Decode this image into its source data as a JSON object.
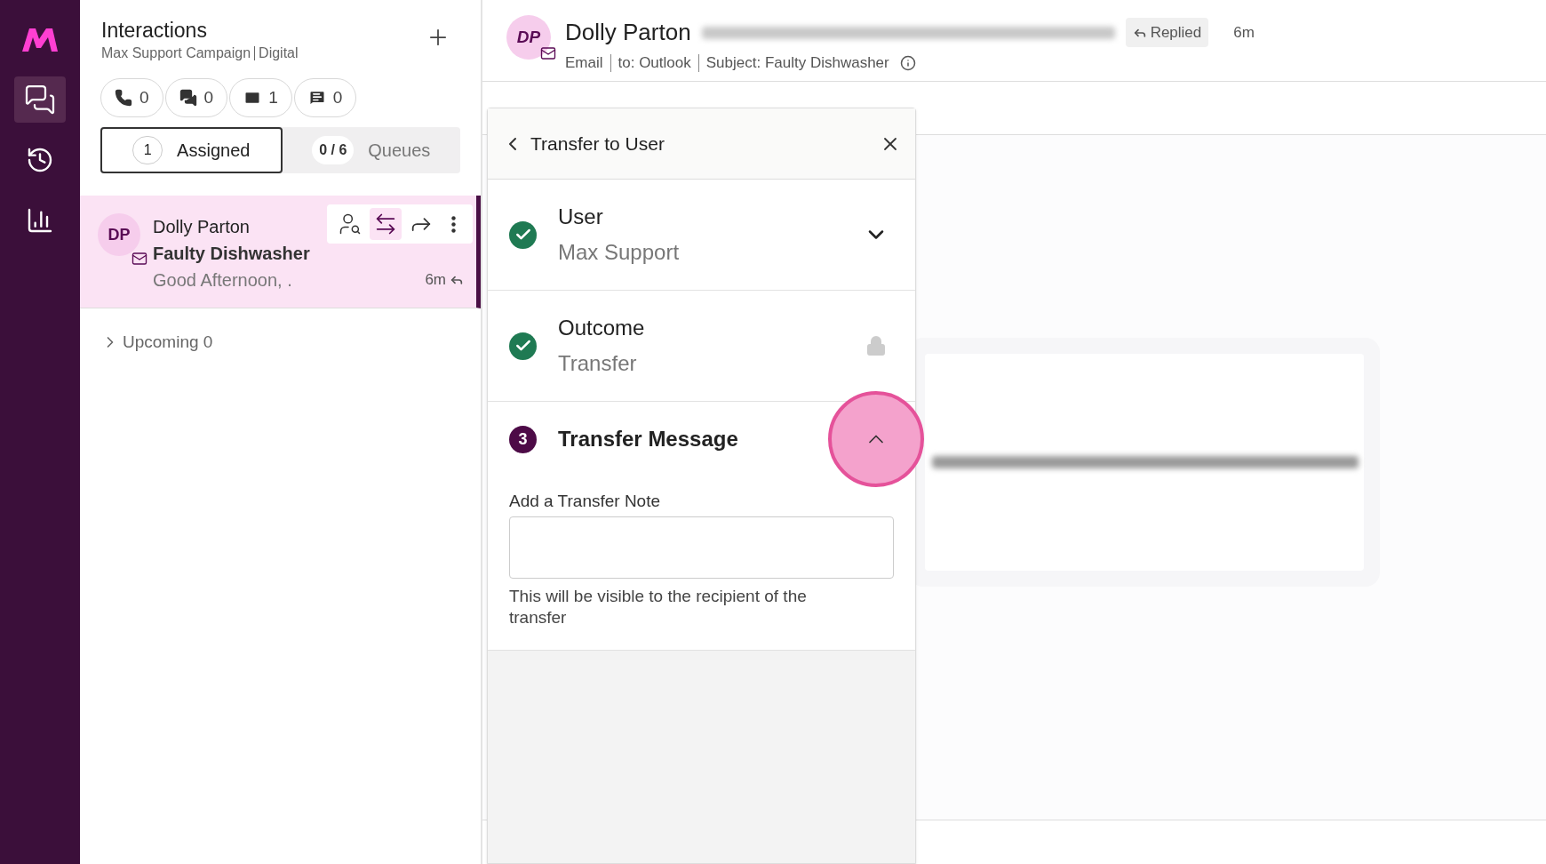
{
  "nav": {
    "items": [
      {
        "kind": "interactions",
        "selected": true
      },
      {
        "kind": "history",
        "selected": false
      },
      {
        "kind": "reports",
        "selected": false
      }
    ]
  },
  "interactions": {
    "title": "Interactions",
    "campaign": "Max Support Campaign",
    "channel": "Digital",
    "counters": [
      {
        "kind": "phone",
        "count": "0"
      },
      {
        "kind": "chat",
        "count": "0"
      },
      {
        "kind": "email",
        "count": "1"
      },
      {
        "kind": "sms",
        "count": "0"
      }
    ],
    "tabs": [
      {
        "label": "Assigned",
        "count": "1",
        "selected": true
      },
      {
        "label": "Queues",
        "count": "0 / 6",
        "selected": false
      }
    ],
    "items": [
      {
        "initials": "DP",
        "name": "Dolly Parton",
        "subject": "Faulty Dishwasher",
        "preview": "Good Afternoon, .",
        "time": "6m",
        "selected": true
      }
    ],
    "upcoming": {
      "label": "Upcoming 0",
      "expanded": false
    }
  },
  "header": {
    "initials": "DP",
    "name": "Dolly Parton",
    "status": "Replied",
    "time": "6m",
    "channel": "Email",
    "to": "to: Outlook",
    "subject": "Subject: Faulty Dishwasher"
  },
  "transfer": {
    "title": "Transfer to User",
    "steps": [
      {
        "kind": "done",
        "title": "User",
        "value": "Max Support",
        "expanded": false,
        "locked": false,
        "highlighted": false
      },
      {
        "kind": "done",
        "title": "Outcome",
        "value": "Transfer",
        "expanded": false,
        "locked": true,
        "highlighted": false
      },
      {
        "kind": "current",
        "number": "3",
        "title": "Transfer Message",
        "expanded": true,
        "locked": false,
        "highlighted": true,
        "field_label": "Add a Transfer Note",
        "hint": "This will be visible to the recipient of the transfer"
      }
    ]
  }
}
